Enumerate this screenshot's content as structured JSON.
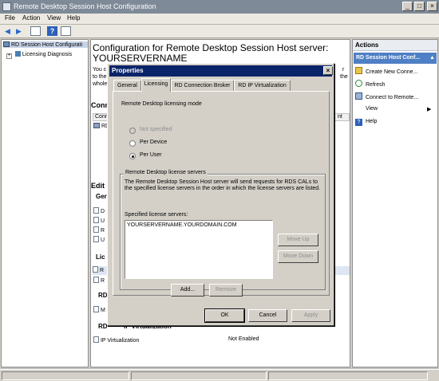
{
  "window": {
    "title": "Remote Desktop Session Host Configuration",
    "min": "_",
    "max": "□",
    "close": "×"
  },
  "menu": [
    "File",
    "Action",
    "View",
    "Help"
  ],
  "tree": {
    "root": "RD Session Host Configurati",
    "child": "Licensing Diagnosis"
  },
  "center": {
    "heading_line1": "Configuration for Remote Desktop Session Host server:",
    "heading_line2": "YOURSERVERNAME",
    "desc1": "You c",
    "desc2": "to the",
    "desc3": "whole.",
    "desc_right1": "r",
    "desc_right2": "the",
    "conn_label": "Conn",
    "conn_col": "Conne",
    "conn_col_right": "nt",
    "conn_row": "RD",
    "edit_label": "Edit",
    "gen_label": "Ger",
    "lic_label": "Lic",
    "r1": "D",
    "r2": "U",
    "r3": "R",
    "r4": "U",
    "r5": "R",
    "r6": "R",
    "rd_label": "RD",
    "m_row": "M",
    "rd2_label": "RD",
    "ipv_label": "IP Virtualization",
    "ipv_row_label": "IP Virtualization",
    "ipv_row_value": "Not Enabled"
  },
  "actions": {
    "header": "Actions",
    "section": "RD Session Host Conf...",
    "items": [
      "Create New Conne...",
      "Refresh",
      "Connect to Remote...",
      "View",
      "Help"
    ]
  },
  "dialog": {
    "title": "Properties",
    "close": "×",
    "tabs": [
      "General",
      "Licensing",
      "RD Connection Broker",
      "RD IP Virtualization"
    ],
    "mode_label": "Remote Desktop licensing mode",
    "radios": [
      "Not specified",
      "Per Device",
      "Per User"
    ],
    "servers_group": "Remote Desktop license servers",
    "servers_desc": "The Remote Desktop Session Host server will send requests for RDS CALs to the specified license servers in the order in which the license servers are listed.",
    "servers_list_label": "Specified license servers:",
    "server_entry": "YOURSERVERNAME.YOURDOMAIN.COM",
    "move_up": "Move Up",
    "move_down": "Move Down",
    "add": "Add...",
    "remove": "Remove",
    "ok": "OK",
    "cancel": "Cancel",
    "apply": "Apply"
  }
}
